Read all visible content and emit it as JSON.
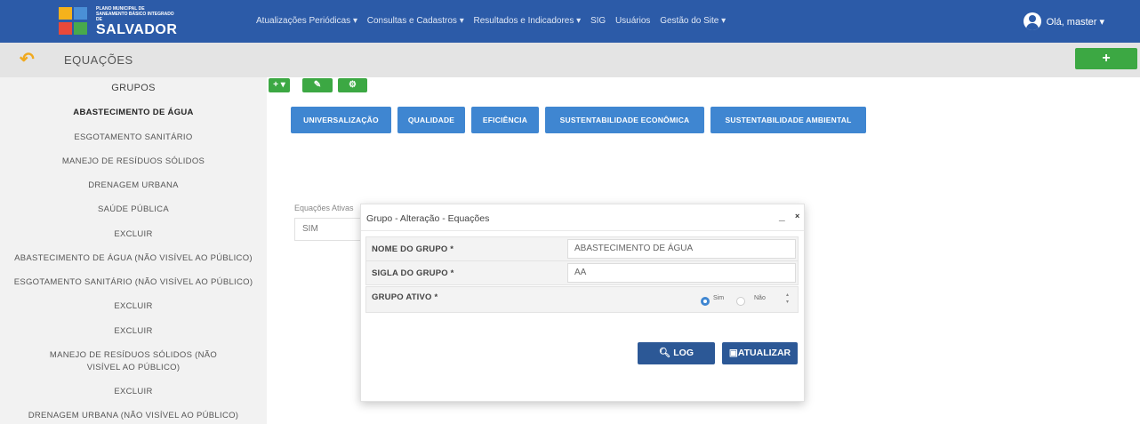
{
  "navbar": {
    "logo_small": "PLANO MUNICIPAL DE SANEAMENTO BÁSICO INTEGRADO DE",
    "logo_big": "SALVADOR",
    "menu": [
      "Atualizações Periódicas ▾",
      "Consultas e Cadastros ▾",
      "Resultados e Indicadores ▾",
      "SIG",
      "Usuários",
      "Gestão do Site ▾"
    ],
    "user_label": "Olá, master ▾"
  },
  "titlebar": {
    "title": "EQUAÇÕES",
    "back_icon": "undo-arrow-icon",
    "add_label": "+"
  },
  "sidebar": {
    "header": "GRUPOS",
    "items": [
      "ABASTECIMENTO DE ÁGUA",
      "ESGOTAMENTO SANITÁRIO",
      "MANEJO DE RESÍDUOS SÓLIDOS",
      "DRENAGEM URBANA",
      "SAÚDE PÚBLICA",
      "EXCLUIR",
      "ABASTECIMENTO DE ÁGUA (NÃO VISÍVEL AO PÚBLICO)",
      "ESGOTAMENTO SANITÁRIO (NÃO VISÍVEL AO PÚBLICO)",
      "EXCLUIR",
      "EXCLUIR",
      "MANEJO DE RESÍDUOS SÓLIDOS (NÃO VISÍVEL AO PÚBLICO)",
      "EXCLUIR",
      "DRENAGEM URBANA (NÃO VISÍVEL AO PÚBLICO)"
    ]
  },
  "toolbar": {
    "add_dropdown": "+ ▾",
    "edit": "✎",
    "settings": "⚙"
  },
  "tabs": [
    "UNIVERSALIZAÇÃO",
    "QUALIDADE",
    "EFICIÊNCIA",
    "SUSTENTABILIDADE ECONÔMICA",
    "SUSTENTABILIDADE AMBIENTAL"
  ],
  "background_form": {
    "label": "Equações Ativas",
    "value": "SIM"
  },
  "modal": {
    "title": "Grupo - Alteração - Equações",
    "minimize": "_",
    "close": "×",
    "fields": {
      "nome_label": "NOME DO GRUPO *",
      "nome_value": "ABASTECIMENTO DE ÁGUA",
      "sigla_label": "SIGLA DO GRUPO *",
      "sigla_value": "AA",
      "ativo_label": "GRUPO ATIVO *",
      "ativo_options": [
        "Sim",
        "Não"
      ],
      "ativo_selected": "Sim"
    },
    "log_button": "LOG",
    "update_button": "ATUALIZAR"
  },
  "colors": {
    "navbar": "#2c5ba8",
    "tab_blue": "#3f86d1",
    "green": "#3ca843",
    "dark_button": "#2c5896"
  }
}
